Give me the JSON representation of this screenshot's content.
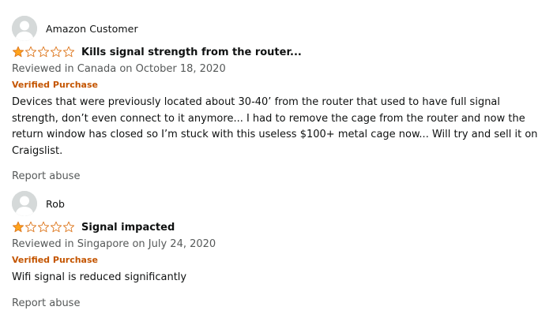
{
  "reviews": [
    {
      "name": "Amazon Customer",
      "rating": 1,
      "title": "Kills signal strength from the router...",
      "meta": "Reviewed in Canada on October 18, 2020",
      "verified": "Verified Purchase",
      "body": "Devices that were previously located about 30-40’ from the router that used to have full signal strength, don’t even connect to it anymore... I had to remove the cage from the router and now the return window has closed so I’m stuck with this useless $100+ metal cage now... Will try and sell it on Craigslist.",
      "report": "Report abuse"
    },
    {
      "name": "Rob",
      "rating": 1,
      "title": "Signal impacted",
      "meta": "Reviewed in Singapore on July 24, 2020",
      "verified": "Verified Purchase",
      "body": "Wifi signal is reduced significantly",
      "report": "Report abuse"
    }
  ],
  "colors": {
    "star_fill": "#ffa41c",
    "star_stroke": "#de7921",
    "verified": "#c45500",
    "avatar_bg": "#d5d9d9"
  },
  "icons": {
    "avatar": "default-avatar-icon",
    "star_filled": "star-filled-icon",
    "star_empty": "star-empty-icon"
  }
}
